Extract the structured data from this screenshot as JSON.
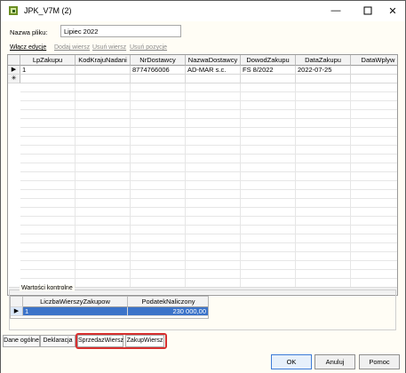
{
  "window": {
    "title": "JPK_V7M (2)"
  },
  "filename": {
    "label": "Nazwa pliku:",
    "value": "Lipiec 2022"
  },
  "toolbar": {
    "edit": "Włącz edycje",
    "add_row": "Dodaj wiersz",
    "delete_row": "Usuń wiersz",
    "delete_item": "Usuń pozycje"
  },
  "main_grid": {
    "columns": [
      "LpZakupu",
      "KodKrajuNadani",
      "NrDostawcy",
      "NazwaDostawcy",
      "DowodZakupu",
      "DataZakupu",
      "DataWplyw"
    ],
    "rows": [
      [
        "1",
        "",
        "8774766006",
        "AD-MAR s.c.",
        "FS 8/2022",
        "2022-07-25",
        ""
      ]
    ],
    "current_row_marker": "▶",
    "new_row_marker": "✳"
  },
  "summary": {
    "legend": "Wartości kontrolne",
    "columns": [
      "LiczbaWierszyZakupow",
      "PodatekNaliczony"
    ],
    "rows": [
      [
        "1",
        "230 000,00"
      ]
    ],
    "current_row_marker": "▶"
  },
  "tabs": [
    "Dane ogólne",
    "Deklaracja",
    "SprzedazWiersz",
    "ZakupWiersz"
  ],
  "buttons": {
    "ok": "OK",
    "cancel": "Anuluj",
    "help": "Pomoc"
  },
  "colors": {
    "highlight": "#d62f2f",
    "background": "#fffdf5",
    "selected_row": "#3b73c9"
  }
}
